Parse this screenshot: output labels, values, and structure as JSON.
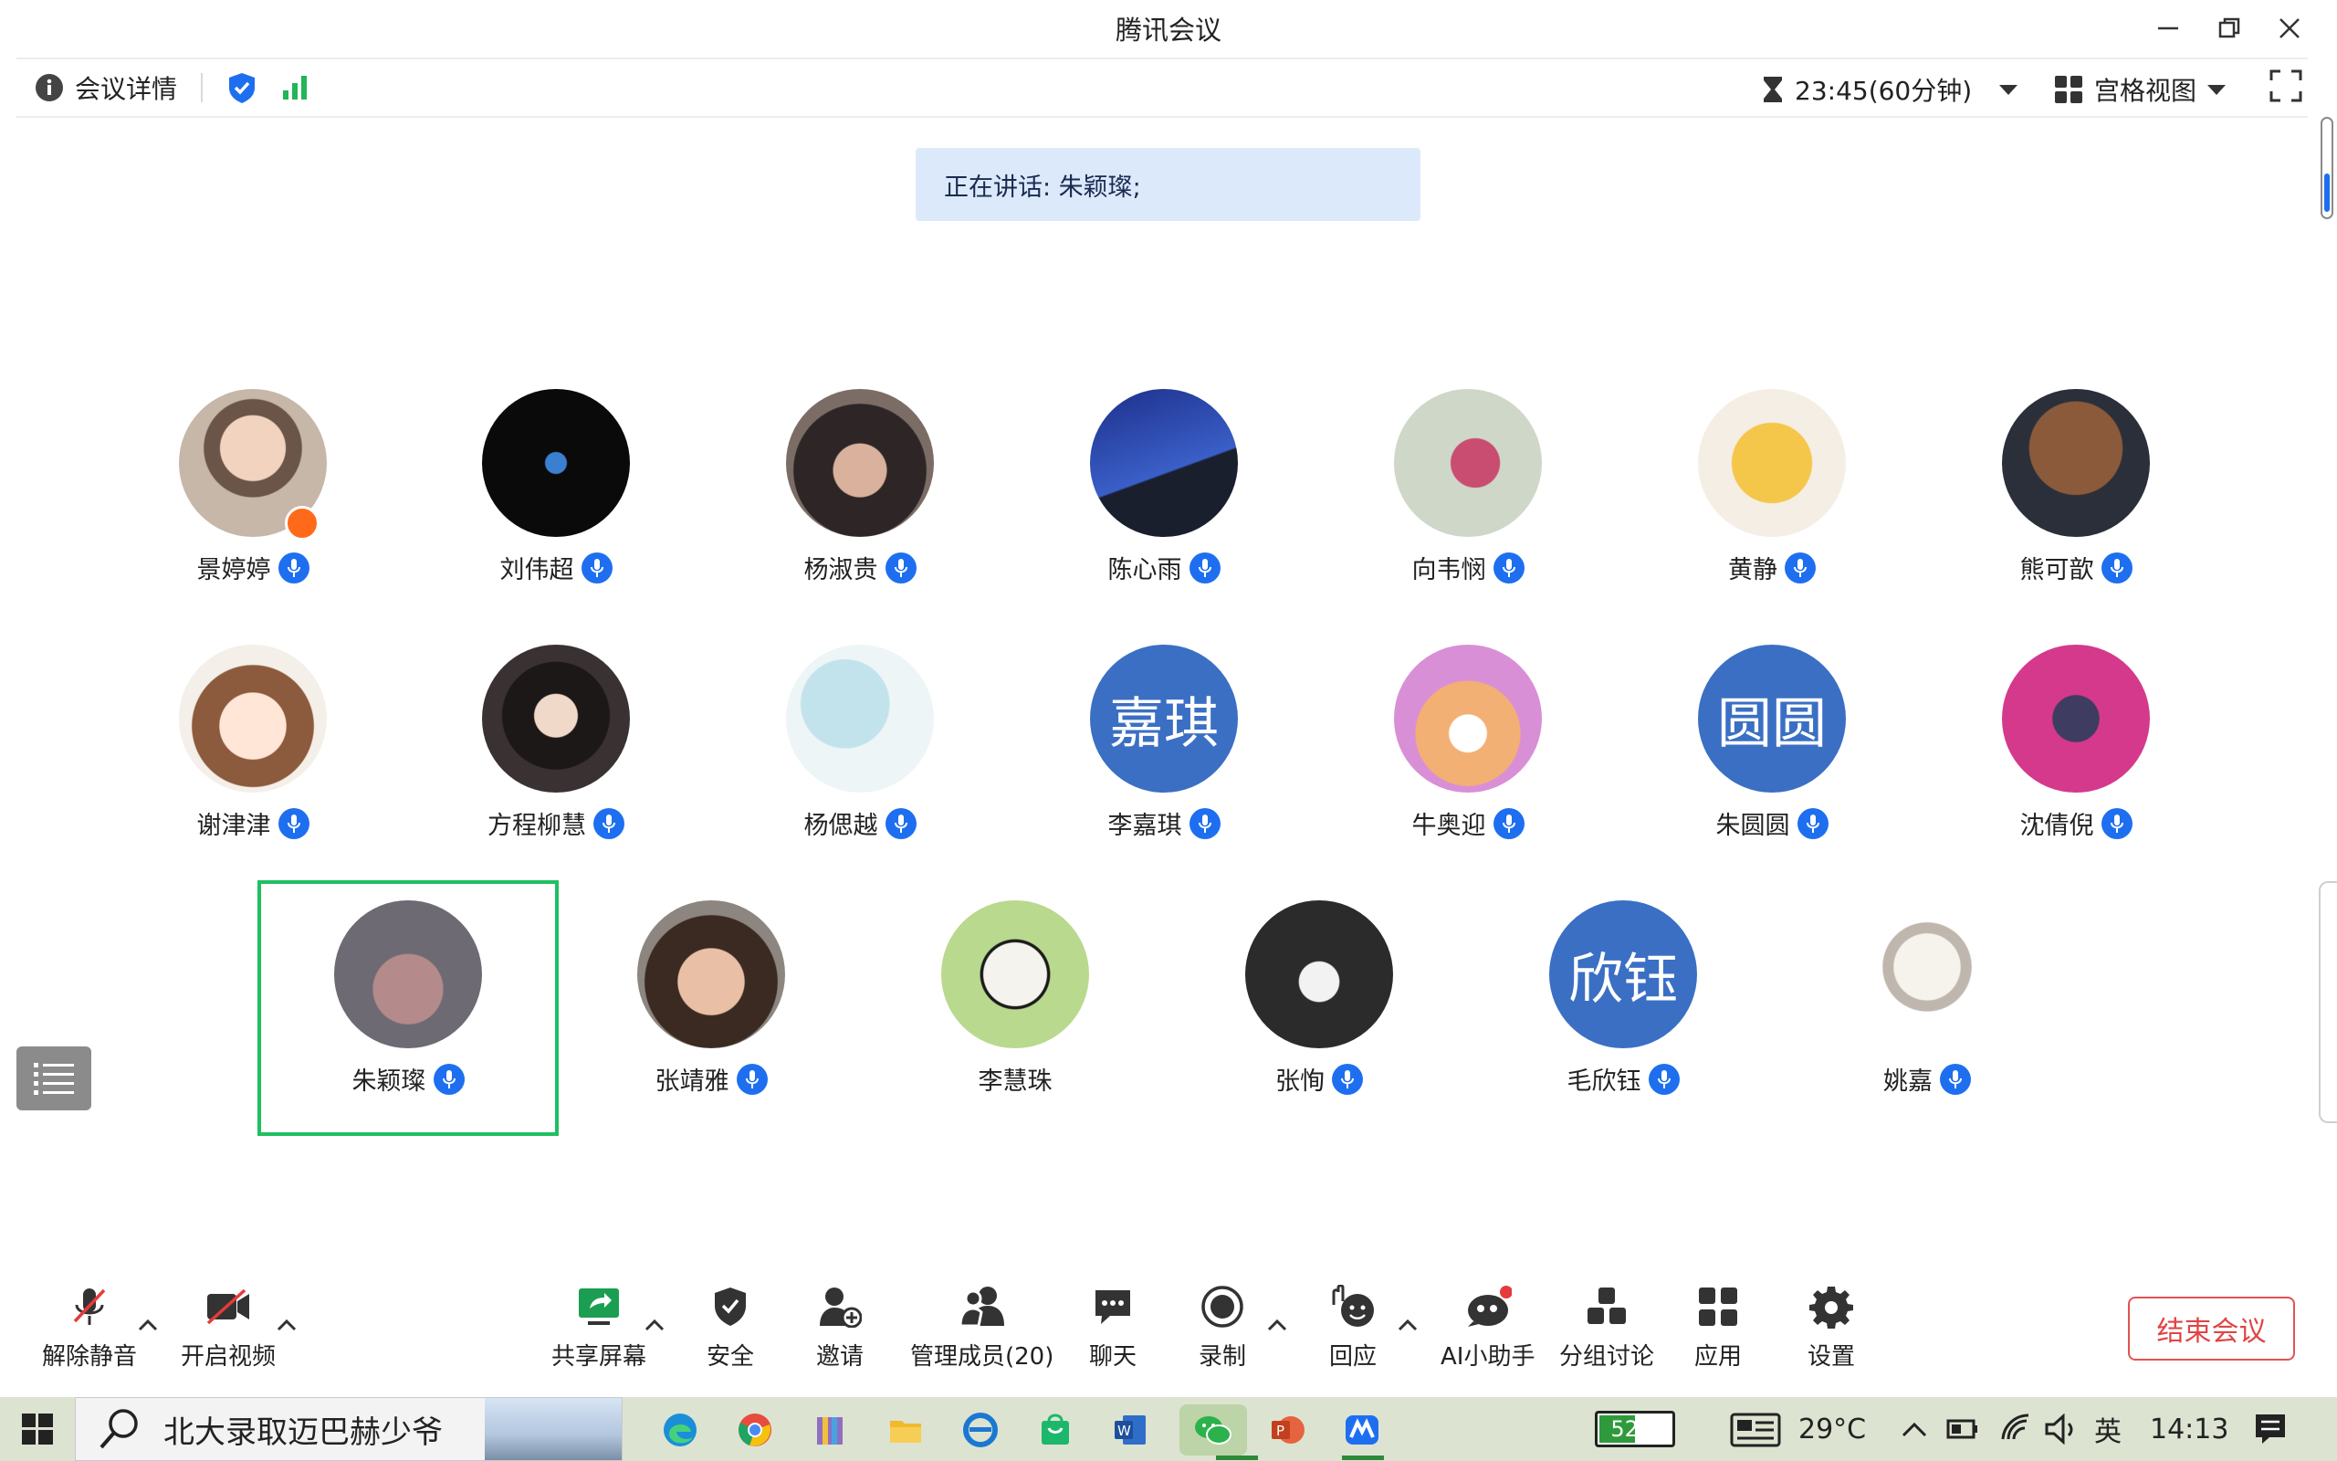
{
  "window": {
    "title": "腾讯会议"
  },
  "topbar": {
    "meeting_info": "会议详情",
    "timer": "23:45(60分钟)",
    "view_mode": "宫格视图"
  },
  "speaking": {
    "text": "正在讲话: 朱颖璨;"
  },
  "participants": [
    {
      "name": "景婷婷",
      "avatar": "photo-girl",
      "mic": true,
      "host": true
    },
    {
      "name": "刘伟超",
      "avatar": "photo-earth",
      "mic": true
    },
    {
      "name": "杨淑贵",
      "avatar": "photo-face",
      "mic": true
    },
    {
      "name": "陈心雨",
      "avatar": "photo-sky",
      "mic": true
    },
    {
      "name": "向韦悯",
      "avatar": "photo-cartoon",
      "mic": true
    },
    {
      "name": "黄静",
      "avatar": "photo-doge",
      "mic": true
    },
    {
      "name": "熊可歆",
      "avatar": "photo-bear",
      "mic": true
    },
    {
      "name": "谢津津",
      "avatar": "photo-chibi",
      "mic": true
    },
    {
      "name": "方程柳慧",
      "avatar": "photo-woman",
      "mic": true
    },
    {
      "name": "杨偲越",
      "avatar": "photo-watercolor",
      "mic": true
    },
    {
      "name": "李嘉琪",
      "avatar_text": "嘉琪",
      "mic": true
    },
    {
      "name": "牛奥迎",
      "avatar": "photo-bunny",
      "mic": true
    },
    {
      "name": "朱圆圆",
      "avatar_text": "圆圆",
      "mic": true
    },
    {
      "name": "沈倩倪",
      "avatar": "photo-pink",
      "mic": true
    },
    {
      "name": "朱颖璨",
      "avatar": "photo-clouds",
      "mic": true,
      "speaking": true
    },
    {
      "name": "张靖雅",
      "avatar": "photo-kid",
      "mic": true
    },
    {
      "name": "李慧珠",
      "avatar": "photo-dog",
      "mic": false
    },
    {
      "name": "张恂",
      "avatar": "photo-group",
      "mic": true
    },
    {
      "name": "毛欣钰",
      "avatar_text": "欣钰",
      "mic": true
    },
    {
      "name": "姚嘉",
      "avatar": "photo-cat",
      "mic": true
    }
  ],
  "toolbar": {
    "unmute": "解除静音",
    "video": "开启视频",
    "share": "共享屏幕",
    "security": "安全",
    "invite": "邀请",
    "members": "管理成员(20)",
    "chat": "聊天",
    "record": "录制",
    "react": "回应",
    "ai": "AI小助手",
    "breakout": "分组讨论",
    "apps": "应用",
    "settings": "设置",
    "end": "结束会议"
  },
  "taskbar": {
    "search_text": "北大录取迈巴赫少爷",
    "battery": "52%",
    "battery_level": 52,
    "weather": "29°C",
    "ime": "英",
    "time": "14:13"
  },
  "colors": {
    "accent": "#1e6ff0",
    "speaking_border": "#1fbf62",
    "end_button": "#e04545",
    "text_avatar": "#3a6fc4"
  }
}
